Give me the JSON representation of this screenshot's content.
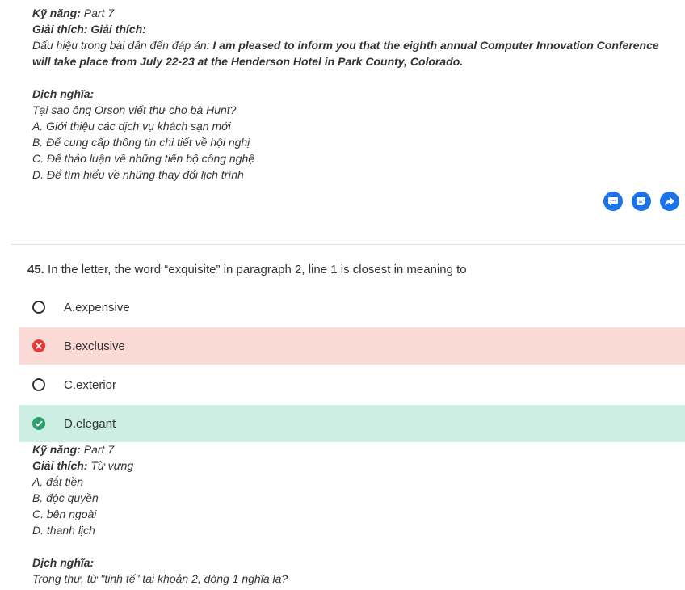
{
  "prev_explanation": {
    "skill_label": "Kỹ năng:",
    "skill_value": "Part 7",
    "explain_label": "Giải thích: Giải thích:",
    "clue_prefix": "Dấu hiệu trong bài dẫn đến đáp án:",
    "clue_text": "I am pleased to inform you that the eighth annual Computer Innovation Conference will take place from July 22-23 at the Henderson Hotel in Park County, Colorado.",
    "translation_label": "Dịch nghĩa:",
    "translation_lines": [
      "Tại sao ông Orson viết thư cho bà Hunt?",
      "A. Giới thiệu các dịch vụ khách sạn mới",
      "B. Để cung cấp thông tin chi tiết về hội nghị",
      "C. Để thảo luận về những tiến bộ công nghệ",
      "D. Để tìm hiểu về những thay đổi lịch trình"
    ]
  },
  "actions": {
    "comment_icon": "comment-icon",
    "note_icon": "note-icon",
    "share_icon": "share-icon",
    "color": "#1a73e8"
  },
  "question": {
    "number": "45.",
    "text": "In the letter, the word “exquisite” in paragraph 2, line 1 is closest in meaning to",
    "options": [
      {
        "label": "A.expensive",
        "state": "unselected"
      },
      {
        "label": "B.exclusive",
        "state": "wrong"
      },
      {
        "label": "C.exterior",
        "state": "unselected"
      },
      {
        "label": "D.elegant",
        "state": "correct"
      }
    ],
    "wrong_color": "#fbd9d4",
    "correct_color": "#cdeee3"
  },
  "explanation": {
    "skill_label": "Kỹ năng:",
    "skill_value": "Part 7",
    "explain_label": "Giải thích:",
    "explain_value": "Từ vựng",
    "lines": [
      "A. đắt tiền",
      "B. độc quyền",
      "C. bên ngoài",
      "D. thanh lịch"
    ],
    "translation_label": "Dịch nghĩa:",
    "translation_text": "Trong thư, từ \"tinh tế\" tại khoản 2, dòng 1 nghĩa là?"
  }
}
